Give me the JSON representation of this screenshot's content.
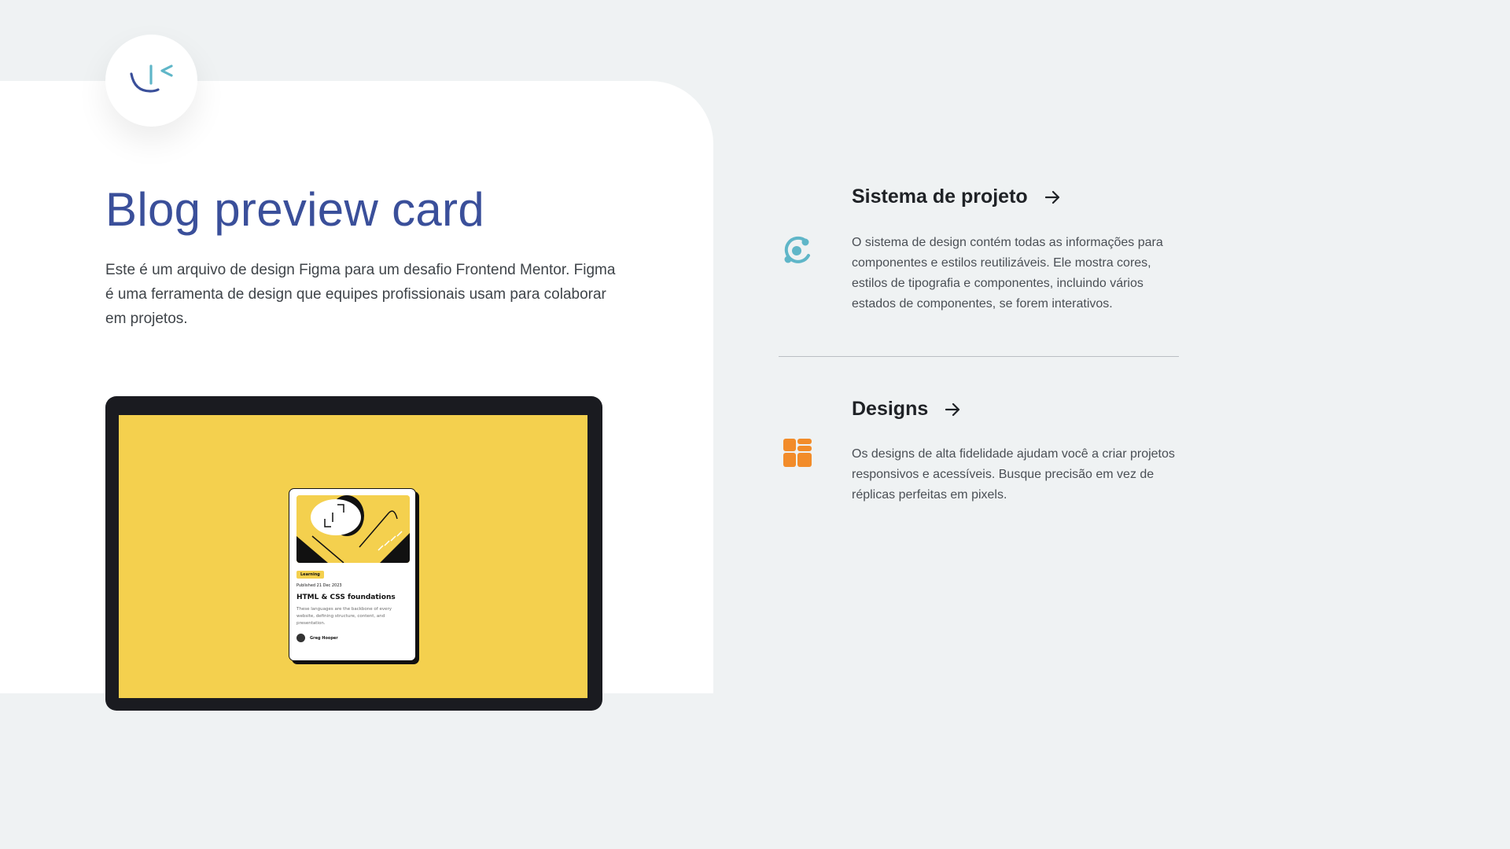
{
  "page": {
    "title": "Blog preview card",
    "intro": "Este é um arquivo de design Figma para um desafio Frontend Mentor. Figma é uma ferramenta de design que equipes profissionais usam para colaborar em projetos."
  },
  "preview_card": {
    "tag": "Learning",
    "date": "Published 21 Dec 2023",
    "title": "HTML & CSS foundations",
    "description": "These languages are the backbone of every website, defining structure, content, and presentation.",
    "author": "Greg Hooper"
  },
  "features": [
    {
      "title": "Sistema de projeto",
      "text": "O sistema de design contém todas as informações para componentes e estilos reutilizáveis. Ele mostra cores, estilos de tipografia e componentes, incluindo vários estados de componentes, se forem interativos.",
      "icon": "design-system-icon"
    },
    {
      "title": "Designs",
      "text": "Os designs de alta fidelidade ajudam você a criar projetos responsivos e acessíveis. Busque precisão em vez de réplicas perfeitas em pixels.",
      "icon": "layout-icon"
    }
  ],
  "colors": {
    "title_blue": "#3a4f9a",
    "accent_yellow": "#f4d04e",
    "teal": "#5fb6c8",
    "orange": "#f28c2a",
    "background": "#eff2f3"
  }
}
